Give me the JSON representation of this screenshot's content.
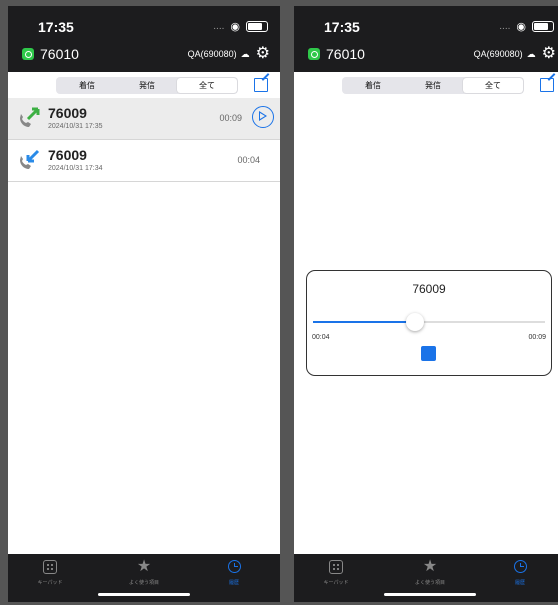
{
  "status": {
    "time": "17:35",
    "signal": "....",
    "wifi": "wifi-icon",
    "battery": "battery-icon"
  },
  "header": {
    "extension": "76010",
    "server": "QA(690080)",
    "cloud_icon": "cloud-icon",
    "settings_icon": "gear-icon"
  },
  "segments": [
    "着信",
    "発信",
    "全て"
  ],
  "active_segment": "全て",
  "calls": [
    {
      "number": "76009",
      "datetime": "2024/10/31 17:35",
      "duration": "00:09",
      "direction": "outgoing"
    },
    {
      "number": "76009",
      "datetime": "2024/10/31 17:34",
      "duration": "00:04",
      "direction": "incoming"
    }
  ],
  "player": {
    "number": "76009",
    "elapsed": "00:04",
    "total": "00:09",
    "progress": 0.44
  },
  "tabs": [
    {
      "label": "キーパッド",
      "icon": "keypad-icon"
    },
    {
      "label": "よく使う項目",
      "icon": "star-icon"
    },
    {
      "label": "履歴",
      "icon": "clock-icon"
    }
  ],
  "colors": {
    "accent": "#1a73e8",
    "app_green": "#2fc84a",
    "dark_bar": "#1c1c1e"
  }
}
